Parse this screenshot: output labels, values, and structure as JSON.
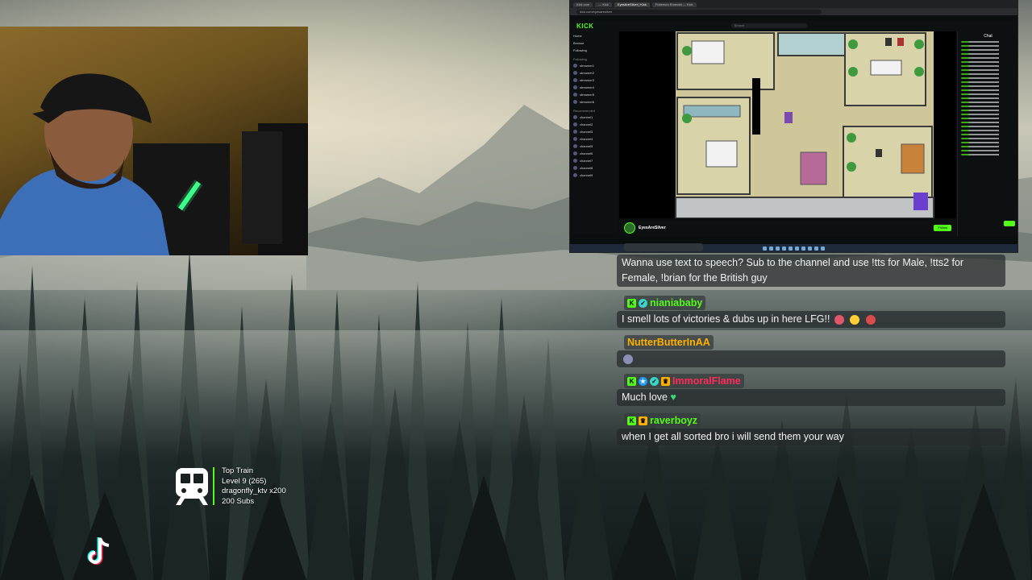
{
  "browser": {
    "tabs": [
      "Kick.com",
      "— Kick",
      "EyesAreSilver | Kick",
      "Pokemon Emerald — Kick"
    ],
    "address": "kick.com/eyesaresilver",
    "kick_logo": "KICK",
    "search_placeholder": "Search",
    "sidebar": {
      "nav": [
        "Home",
        "Browse",
        "Following"
      ],
      "following_header": "Following",
      "following": [
        "streamer1",
        "streamer2",
        "streamer3",
        "streamer4",
        "streamer5",
        "streamer6"
      ],
      "recommended_header": "Recommended",
      "recommended": [
        "channel1",
        "channel2",
        "channel3",
        "channel4",
        "channel5",
        "channel6",
        "channel7",
        "channel8",
        "channel9"
      ]
    },
    "stream": {
      "name": "EyesAreSilver",
      "follow_label": "Follow"
    },
    "chat_header": "Chat"
  },
  "chat": {
    "messages": [
      {
        "username": "",
        "color": "#53fc18",
        "badges": [],
        "text_line1": "Wanna use text to speech? Sub to the channel and use !tts for Male, !tts2 for",
        "text_line2": "Female, !brian for the British guy"
      },
      {
        "username": "nianiababy",
        "color": "#53fc18",
        "badges": [
          "k",
          "o"
        ],
        "text": "I smell lots of victories & dubs up in here LFG!!"
      },
      {
        "username": "NutterButterInAA",
        "color": "#ffb000",
        "badges": [],
        "text": ""
      },
      {
        "username": "ImmoralFlame",
        "color": "#ff2a5a",
        "badges": [
          "k",
          "v",
          "o",
          "c"
        ],
        "text": "Much love"
      },
      {
        "username": "raverboyz",
        "color": "#53fc18",
        "badges": [
          "k",
          "c"
        ],
        "text": "when I get all sorted bro i will send them your way"
      }
    ]
  },
  "top_train": {
    "title": "Top Train",
    "level": "Level 9  (265)",
    "top_user": "dragonfly_ktv x200",
    "subs": "200 Subs"
  },
  "icons": {
    "train": "train-icon",
    "tiktok": "tiktok-icon"
  }
}
